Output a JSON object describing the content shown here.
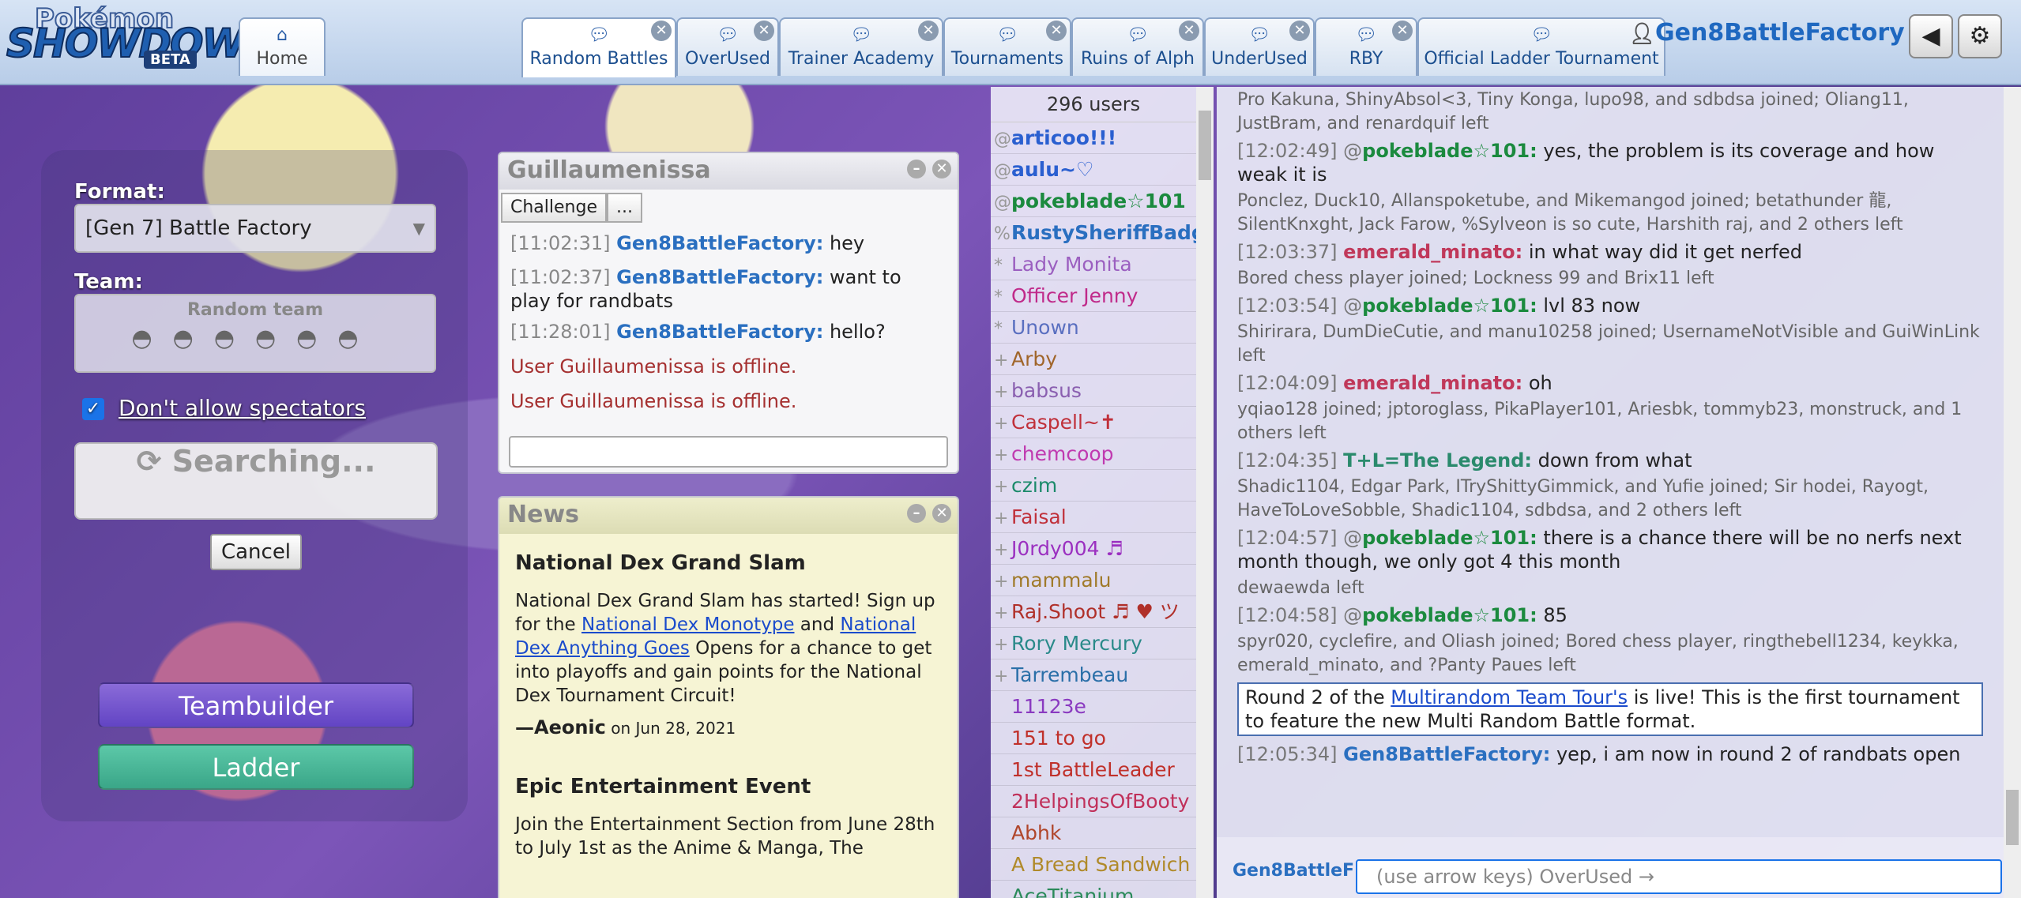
{
  "header": {
    "logo_top": "Pokémon",
    "logo_main": "SHOWDOWN!",
    "logo_badge": "BETA",
    "tabs": [
      {
        "label": "Home",
        "icon": "home-icon"
      },
      {
        "label": "Random Battles",
        "icon": "chat-icon"
      },
      {
        "label": "OverUsed",
        "icon": "chat-icon"
      },
      {
        "label": "Trainer Academy",
        "icon": "chat-icon"
      },
      {
        "label": "Tournaments",
        "icon": "chat-icon"
      },
      {
        "label": "Ruins of Alph",
        "icon": "chat-icon"
      },
      {
        "label": "UnderUsed",
        "icon": "chat-icon"
      },
      {
        "label": "RBY",
        "icon": "chat-icon"
      },
      {
        "label": "Official Ladder Tournament",
        "icon": "chat-icon"
      }
    ],
    "username": "Gen8BattleFactory",
    "sound_icon": "sound-icon",
    "settings_icon": "gear-icon"
  },
  "mainmenu": {
    "format_label": "Format:",
    "format_value": "[Gen 7] Battle Factory",
    "team_label": "Team:",
    "team_value": "Random team",
    "spectators_label": "Don't allow spectators",
    "spectators_checked": true,
    "searching_label": "Searching...",
    "cancel_label": "Cancel",
    "teambuilder_label": "Teambuilder",
    "ladder_label": "Ladder"
  },
  "pm": {
    "title": "Guillaumenissa",
    "challenge_label": "Challenge",
    "more_label": "...",
    "messages": [
      {
        "time": "[11:02:31]",
        "user": "Gen8BattleFactory:",
        "text": "hey"
      },
      {
        "time": "[11:02:37]",
        "user": "Gen8BattleFactory:",
        "text": "want to",
        "text2": "play for randbats"
      },
      {
        "time": "[11:28:01]",
        "user": "Gen8BattleFactory:",
        "text": "hello?"
      }
    ],
    "offline": [
      "User Guillaumenissa is offline.",
      "User Guillaumenissa is offline."
    ]
  },
  "news": {
    "title": "News",
    "items": [
      {
        "headline": "National Dex Grand Slam",
        "body_a": "National Dex Grand Slam has started! Sign up for the ",
        "link1": "National Dex Monotype",
        "body_b": " and ",
        "link2": "National Dex Anything Goes",
        "body_c": " Opens for a chance to get into playoffs and gain points for the National Dex Tournament Circuit!",
        "author_prefix": "—",
        "author": "Aeonic",
        "date": "on Jun 28, 2021"
      },
      {
        "headline": "Epic Entertainment Event",
        "body_a": "Join the Entertainment Section from June 28th to July 1st as the Anime & Manga, The"
      }
    ]
  },
  "userlist": {
    "count": "296 users",
    "users": [
      {
        "rank": "@",
        "name": "articoo!!!",
        "color": "#2a5fd0",
        "bold": true
      },
      {
        "rank": "@",
        "name": "aulu~♡",
        "color": "#2a5fd0",
        "bold": true
      },
      {
        "rank": "@",
        "name": "pokeblade☆101",
        "color": "#1b8a3e",
        "bold": true
      },
      {
        "rank": "%",
        "name": "RustySheriffBadge",
        "color": "#2a6fc0",
        "bold": true
      },
      {
        "rank": "*",
        "name": "Lady Monita",
        "color": "#9b5fc0",
        "bold": false
      },
      {
        "rank": "*",
        "name": "Officer Jenny",
        "color": "#c02a8a",
        "bold": false
      },
      {
        "rank": "*",
        "name": "Unown",
        "color": "#5a6fc0",
        "bold": false
      },
      {
        "rank": "+",
        "name": "Arby",
        "color": "#a0652a",
        "bold": false
      },
      {
        "rank": "+",
        "name": "babsus",
        "color": "#8a5fb0",
        "bold": false
      },
      {
        "rank": "+",
        "name": "Caspell~✝",
        "color": "#c0303a",
        "bold": false
      },
      {
        "rank": "+",
        "name": "chemcoop",
        "color": "#c03ab0",
        "bold": false
      },
      {
        "rank": "+",
        "name": "czim",
        "color": "#1b8a6a",
        "bold": false
      },
      {
        "rank": "+",
        "name": "Faisal",
        "color": "#c0303a",
        "bold": false
      },
      {
        "rank": "+",
        "name": "J0rdy004 ♬",
        "color": "#9b30c0",
        "bold": false
      },
      {
        "rank": "+",
        "name": "mammalu",
        "color": "#a07a2a",
        "bold": false
      },
      {
        "rank": "+",
        "name": "Raj.Shoot ♬ ♥ ツ",
        "color": "#b0302a",
        "bold": false
      },
      {
        "rank": "+",
        "name": "Rory Mercury",
        "color": "#2a8a8a",
        "bold": false
      },
      {
        "rank": "+",
        "name": "Tarrembeau",
        "color": "#2a6fa8",
        "bold": false
      },
      {
        "rank": "",
        "name": "11123e",
        "color": "#8a3ac0",
        "bold": false
      },
      {
        "rank": "",
        "name": "151 to go",
        "color": "#c0302a",
        "bold": false
      },
      {
        "rank": "",
        "name": "1st BattleLeader",
        "color": "#c0302a",
        "bold": false
      },
      {
        "rank": "",
        "name": "2HelpingsOfBooty",
        "color": "#c0305a",
        "bold": false
      },
      {
        "rank": "",
        "name": "Abhk",
        "color": "#b0452a",
        "bold": false
      },
      {
        "rank": "",
        "name": "A Bread Sandwich",
        "color": "#b08a2a",
        "bold": false
      },
      {
        "rank": "",
        "name": "AceTitanium",
        "color": "#2a8a5a",
        "bold": false
      }
    ]
  },
  "chat": {
    "lines": [
      {
        "type": "sys",
        "text": "Pro Kakuna, ShinyAbsol<3, Tiny Konga, lupo98, and sdbdsa joined; Oliang11, JustBram, and renardquif left"
      },
      {
        "type": "msg",
        "time": "[12:02:49]",
        "rank": "@",
        "user": "pokeblade☆101:",
        "cls": "ok",
        "text": "yes, the problem is its coverage and how weak it is"
      },
      {
        "type": "sys",
        "text": "Ponclez, Duck10, Allanspoketube, and Mikemangod joined; betathunder 龍, SilentKnxght, Jack Farow, %Sylveon is so cute, Harshith raj, and 2 others left"
      },
      {
        "type": "msg",
        "time": "[12:03:37]",
        "rank": "",
        "user": "emerald_minato:",
        "cls": "em",
        "text": "in what way did it get nerfed"
      },
      {
        "type": "sys",
        "text": "Bored chess player joined; Lockness 99 and Brix11 left"
      },
      {
        "type": "msg",
        "time": "[12:03:54]",
        "rank": "@",
        "user": "pokeblade☆101:",
        "cls": "ok",
        "text": "lvl 83 now"
      },
      {
        "type": "sys",
        "text": "Shirirara, DumDieCutie, and manu10258 joined; UsernameNotVisible and GuiWinLink left"
      },
      {
        "type": "msg",
        "time": "[12:04:09]",
        "rank": "",
        "user": "emerald_minato:",
        "cls": "em",
        "text": "oh"
      },
      {
        "type": "sys",
        "text": "yqiao128 joined; jptoroglass, PikaPlayer101, Ariesbk, tommyb23, monstruck, and 1 others left"
      },
      {
        "type": "msg",
        "time": "[12:04:35]",
        "rank": "",
        "user": "T+L=The Legend:",
        "cls": "tl",
        "text": "down from what"
      },
      {
        "type": "sys",
        "text": "Shadic1104, Edgar Park, ITryShittyGimmick, and Yufie joined; Sir hodei, Rayogt, HaveToLoveSobble, Shadic1104, sdbdsa, and 2 others left"
      },
      {
        "type": "msg",
        "time": "[12:04:57]",
        "rank": "@",
        "user": "pokeblade☆101:",
        "cls": "ok",
        "text": "there is a chance there will be no nerfs next month though, we only got 4 this month"
      },
      {
        "type": "sys",
        "text": "dewaewda left"
      },
      {
        "type": "msg",
        "time": "[12:04:58]",
        "rank": "@",
        "user": "pokeblade☆101:",
        "cls": "ok",
        "text": "85"
      },
      {
        "type": "sys",
        "text": "spyr020, cyclefire, and Oliash joined; Bored chess player, ringthebell1234, keykka, emerald_minato, and ?Panty Paues left"
      }
    ],
    "announce_a": "Round 2 of the ",
    "announce_link": "Multirandom Team Tour's",
    "announce_b": " is live! This is the first tournament to feature the new Multi Random Battle format.",
    "last_time": "[12:05:34]",
    "last_user": "Gen8BattleFactory:",
    "last_text": "yep, i am now in round 2 of randbats open",
    "me_label": "Gen8BattleF",
    "input_placeholder": "(use arrow keys) OverUsed →"
  }
}
